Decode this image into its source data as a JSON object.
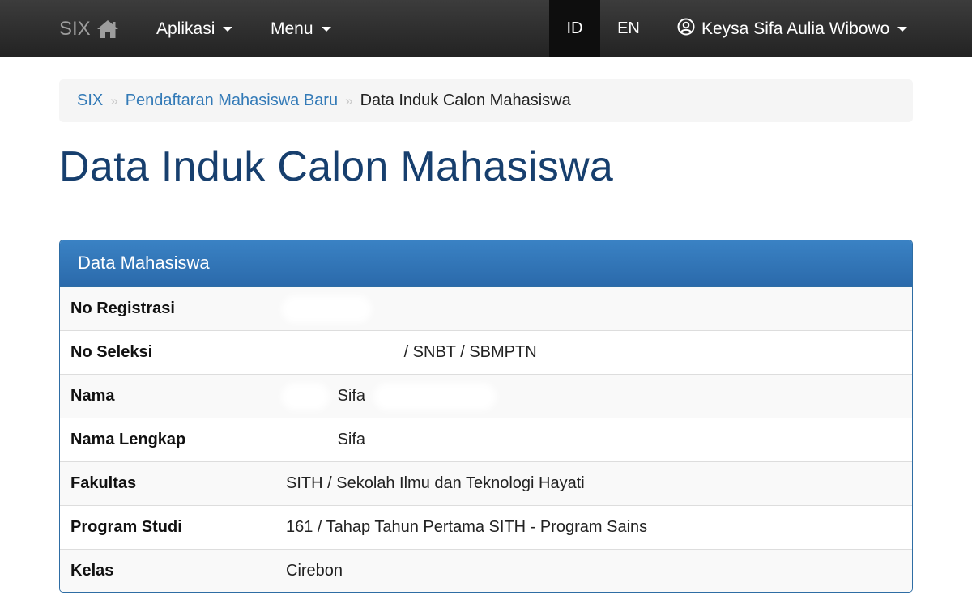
{
  "navbar": {
    "brand": "SIX",
    "brand_icon": "home-icon",
    "menus": [
      {
        "label": "Aplikasi"
      },
      {
        "label": "Menu"
      }
    ],
    "lang_active": "ID",
    "lang_other": "EN",
    "user_name": "Keysa Sifa Aulia Wibowo",
    "user_icon": "user-circle-icon"
  },
  "breadcrumb": {
    "items": [
      "SIX",
      "Pendaftaran Mahasiswa Baru"
    ],
    "active": "Data Induk Calon Mahasiswa",
    "separator": "»"
  },
  "page": {
    "title": "Data Induk Calon Mahasiswa"
  },
  "panel": {
    "heading": "Data Mahasiswa",
    "rows": [
      {
        "label": "No Registrasi",
        "value": ""
      },
      {
        "label": "No Seleksi",
        "value": "/ SNBT / SBMPTN"
      },
      {
        "label": "Nama",
        "value": "Sifa"
      },
      {
        "label": "Nama Lengkap",
        "value": "Sifa"
      },
      {
        "label": "Fakultas",
        "value": "SITH / Sekolah Ilmu dan Teknologi Hayati"
      },
      {
        "label": "Program Studi",
        "value": "161 / Tahap Tahun Pertama SITH - Program Sains"
      },
      {
        "label": "Kelas",
        "value": "Cirebon"
      }
    ]
  },
  "colors": {
    "navbar": "#2b2b2b",
    "link": "#337ab7",
    "title": "#173f6e",
    "panel_heading": "#337ab7"
  }
}
